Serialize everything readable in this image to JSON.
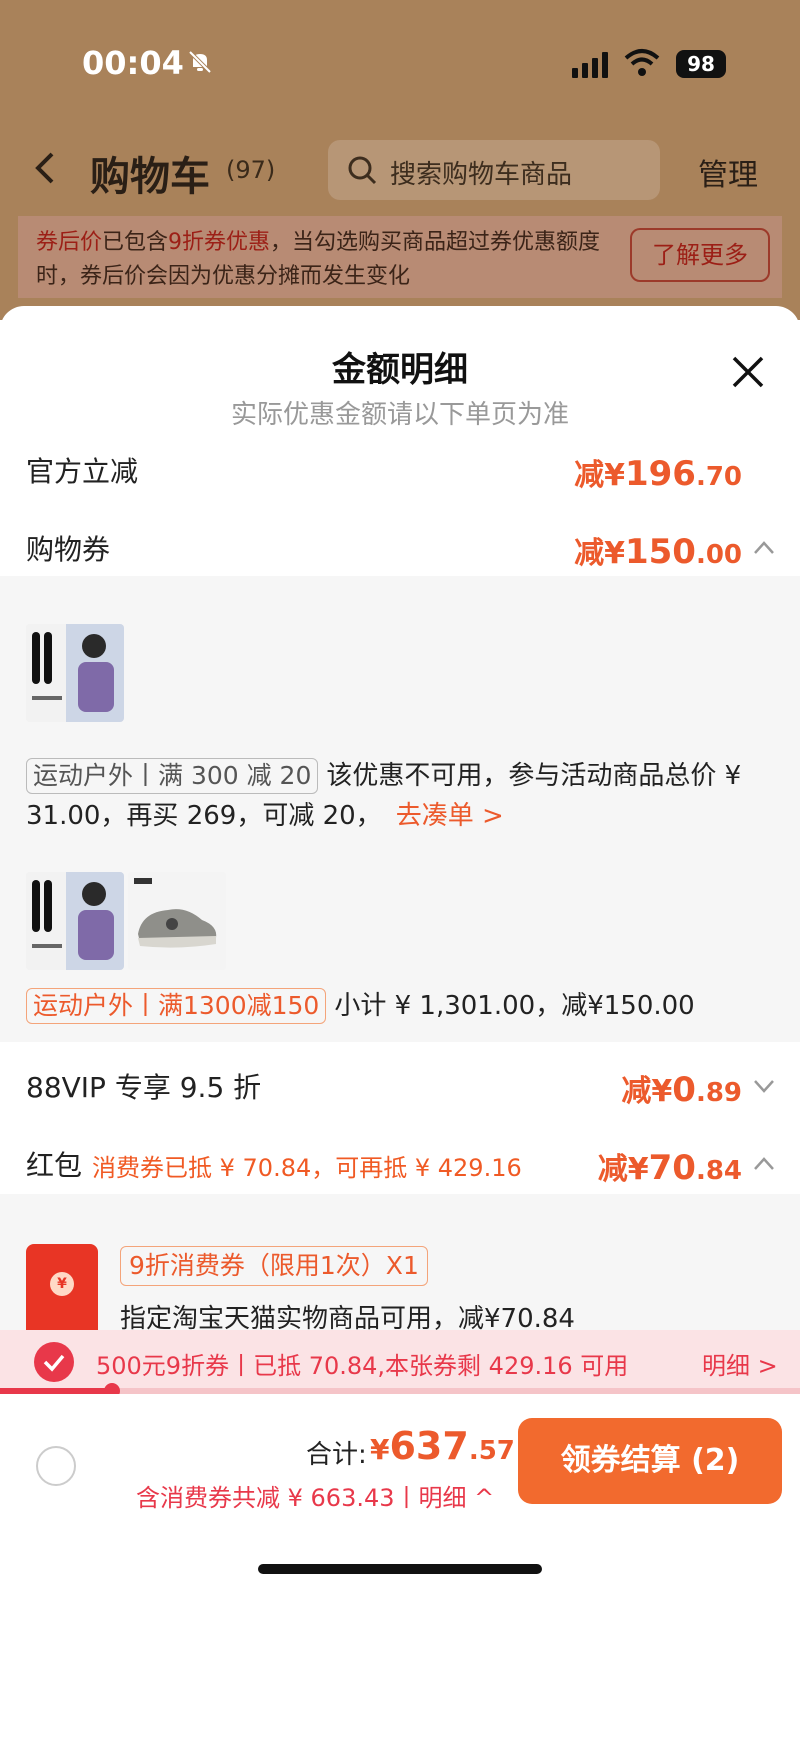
{
  "status": {
    "time": "00:04",
    "battery": "98"
  },
  "nav": {
    "title": "购物车",
    "count": "(97)",
    "search_placeholder": "搜索购物车商品",
    "manage": "管理"
  },
  "notice": {
    "part1": "券后价",
    "part2": "已包含",
    "part3": "9折券优惠",
    "part4": "，当勾选购买商品超过券优惠额度时，券后价会因为优惠分摊而发生变化",
    "button": "了解更多"
  },
  "sheet": {
    "title": "金额明细",
    "subtitle": "实际优惠金额请以下单页为准",
    "rows": {
      "official": {
        "label": "官方立减",
        "prefix": "减¥",
        "int": "196",
        "dec": ".70"
      },
      "coupon": {
        "label": "购物券",
        "prefix": "减¥",
        "int": "150",
        "dec": ".00"
      },
      "vip": {
        "label": "88VIP 专享 9.5 折",
        "prefix": "减¥",
        "int": "0",
        "dec": ".89"
      },
      "redpacket": {
        "label": "红包",
        "sub": "消费券已抵 ¥ 70.84，可再抵 ¥ 429.16",
        "prefix": "减¥",
        "int": "70",
        "dec": ".84"
      }
    },
    "promo1": {
      "tag": "运动户外丨满 300 减 20",
      "text": "该优惠不可用，参与活动商品总价 ¥ 31.00，再买 269，可减 20，",
      "link": "去凑单 >"
    },
    "promo2": {
      "tag": "运动户外丨满1300减150",
      "text": "小计 ¥ 1,301.00，减¥150.00"
    },
    "redpack": {
      "coin": "¥",
      "tag": "9折消费券（限用1次）X1",
      "desc": "指定淘宝天猫实物商品可用，减¥70.84"
    }
  },
  "coupon_bar": {
    "text": "500元9折券丨已抵 70.84,本张券剩 429.16 可用",
    "detail": "明细 >",
    "progress_fraction": 0.14
  },
  "footer": {
    "total_label": "合计:",
    "total_symbol": "¥",
    "total_int": "637",
    "total_dec": ".57",
    "discount": "含消费券共减 ¥ 663.43丨明细 ^",
    "checkout": "领券结算 (2)"
  },
  "colors": {
    "accent": "#ec5a2c",
    "red": "#e8384a",
    "checkout": "#f26a2e"
  }
}
